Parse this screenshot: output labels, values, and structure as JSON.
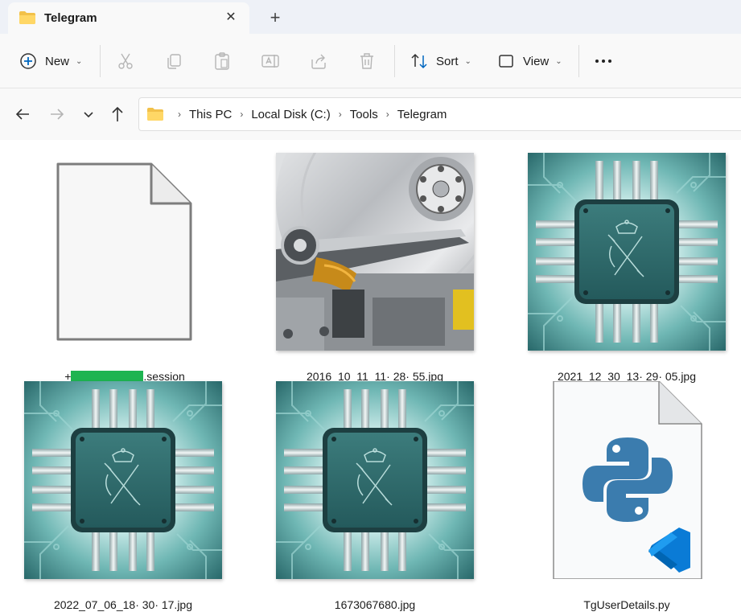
{
  "window": {
    "tab_title": "Telegram",
    "tab_close_icon": "close-icon",
    "new_tab_icon": "plus-icon"
  },
  "toolbar": {
    "new_label": "New",
    "sort_label": "Sort",
    "view_label": "View",
    "icons": [
      "plus-circle-icon",
      "cut-icon",
      "copy-icon",
      "paste-icon",
      "rename-icon",
      "share-icon",
      "delete-icon",
      "sort-icon",
      "view-icon",
      "more-icon"
    ]
  },
  "navigation": {
    "icons": [
      "back-arrow-icon",
      "forward-arrow-icon",
      "recent-chevron-icon",
      "up-arrow-icon"
    ]
  },
  "address": {
    "crumbs": [
      "This PC",
      "Local Disk (C:)",
      "Tools",
      "Telegram"
    ]
  },
  "files": [
    {
      "name_prefix": "+",
      "name_suffix": ".session",
      "kind": "generic-file"
    },
    {
      "name": "2016_10_11_11· 28· 55.jpg",
      "kind": "hard-drive-photo"
    },
    {
      "name": "2021_12_30_13· 29· 05.jpg",
      "kind": "chip-emblem-image"
    },
    {
      "name": "2022_07_06_18· 30· 17.jpg",
      "kind": "chip-emblem-image"
    },
    {
      "name": "1673067680.jpg",
      "kind": "chip-emblem-image"
    },
    {
      "name": "TgUserDetails.py",
      "kind": "python-file"
    }
  ],
  "colors": {
    "accent": "#0067c0",
    "chip_teal": "#2f6e6e",
    "redaction": "#1eb451",
    "python_blue": "#3b7cae",
    "vscode_blue": "#0a7bd6"
  }
}
